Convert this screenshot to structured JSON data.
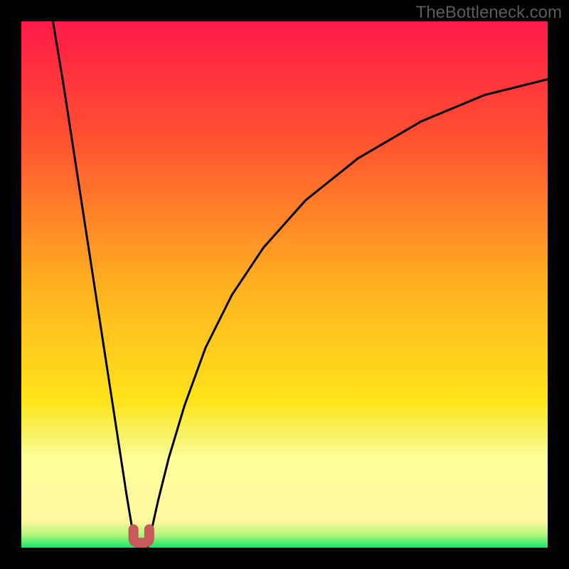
{
  "watermark": "TheBottleneck.com",
  "colors": {
    "frame": "#000000",
    "curve": "#000000",
    "marker": "#c65a5a",
    "grad_top": "#ff1a49",
    "grad_mid1": "#ff6a2e",
    "grad_mid2": "#ffb020",
    "grad_mid3": "#ffe31a",
    "grad_pale": "#fff7a0",
    "grad_green": "#10e867"
  },
  "chart_data": {
    "type": "line",
    "title": "",
    "xlabel": "",
    "ylabel": "",
    "xlim": [
      0,
      100
    ],
    "ylim": [
      0,
      100
    ],
    "legend": false,
    "grid": false,
    "series": [
      {
        "name": "left-branch",
        "x": [
          6,
          8,
          10,
          12,
          14,
          16,
          18,
          20,
          21,
          22
        ],
        "y": [
          100,
          88,
          75,
          62,
          49,
          36,
          23,
          10,
          4,
          0
        ]
      },
      {
        "name": "right-branch",
        "x": [
          24,
          26,
          28,
          31,
          35,
          40,
          46,
          54,
          64,
          76,
          88,
          100
        ],
        "y": [
          0,
          9,
          17,
          27,
          38,
          48,
          57,
          66,
          74,
          81,
          86,
          89
        ]
      }
    ],
    "marker": {
      "name": "u-marker",
      "x_range": [
        21.3,
        24.3
      ],
      "y": 1.5,
      "shape": "U"
    },
    "gradient_bands_pct_from_top": [
      {
        "color": "#ff1a49",
        "stop": 0
      },
      {
        "color": "#ff5030",
        "stop": 22
      },
      {
        "color": "#ffb020",
        "stop": 50
      },
      {
        "color": "#ffe31a",
        "stop": 72
      },
      {
        "color": "#f7f77a",
        "stop": 80.5
      },
      {
        "color": "#ffff9a",
        "stop": 83
      },
      {
        "color": "#fff7a0",
        "stop": 95
      },
      {
        "color": "#b5f57a",
        "stop": 97.5
      },
      {
        "color": "#10e867",
        "stop": 100
      }
    ]
  }
}
